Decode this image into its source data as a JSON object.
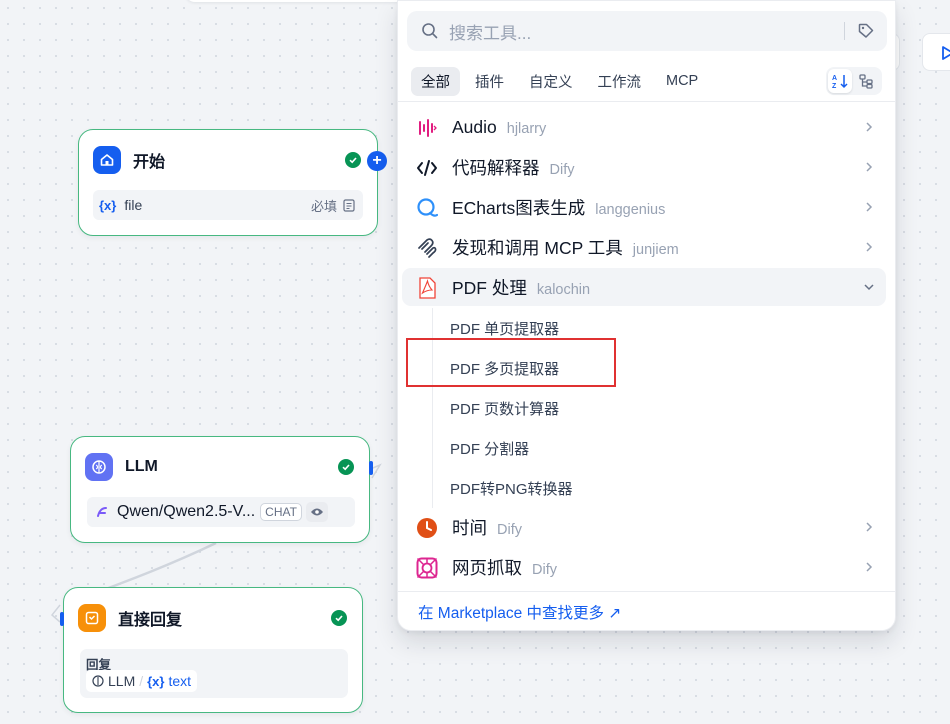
{
  "workflow": {
    "start_node": {
      "title": "开始",
      "var_icon": "{x}",
      "var_name": "file",
      "required": "必填"
    },
    "llm_node": {
      "title": "LLM",
      "model": "Qwen/Qwen2.5-V...",
      "mode": "CHAT"
    },
    "answer_node": {
      "title": "直接回复",
      "field_label": "回复",
      "ref_node": "LLM",
      "sep": "/",
      "var_icon": "{x}",
      "var_name": "text"
    }
  },
  "picker": {
    "search_placeholder": "搜索工具...",
    "tabs": [
      "全部",
      "插件",
      "自定义",
      "工作流",
      "MCP"
    ],
    "active_tab": "全部",
    "tools": [
      {
        "name": "Audio",
        "author": "hjlarry",
        "icon": "audio-tool-icon"
      },
      {
        "name": "代码解释器",
        "author": "Dify",
        "icon": "code-tool-icon"
      },
      {
        "name": "ECharts图表生成",
        "author": "langgenius",
        "icon": "echarts-tool-icon"
      },
      {
        "name": "发现和调用 MCP 工具",
        "author": "junjiem",
        "icon": "mcp-tool-icon"
      },
      {
        "name": "PDF 处理",
        "author": "kalochin",
        "icon": "pdf-tool-icon",
        "expanded": true,
        "actions": [
          "PDF 单页提取器",
          "PDF 多页提取器",
          "PDF 页数计算器",
          "PDF 分割器",
          "PDF转PNG转换器"
        ]
      },
      {
        "name": "时间",
        "author": "Dify",
        "icon": "clock-tool-icon"
      },
      {
        "name": "网页抓取",
        "author": "Dify",
        "icon": "web-scraper-tool-icon"
      }
    ],
    "marketplace_link": "在 Marketplace 中查找更多 ↗"
  },
  "colors": {
    "accent": "#155eef",
    "node_border": "#47b881",
    "success": "#079455",
    "highlight": "#e03131"
  }
}
